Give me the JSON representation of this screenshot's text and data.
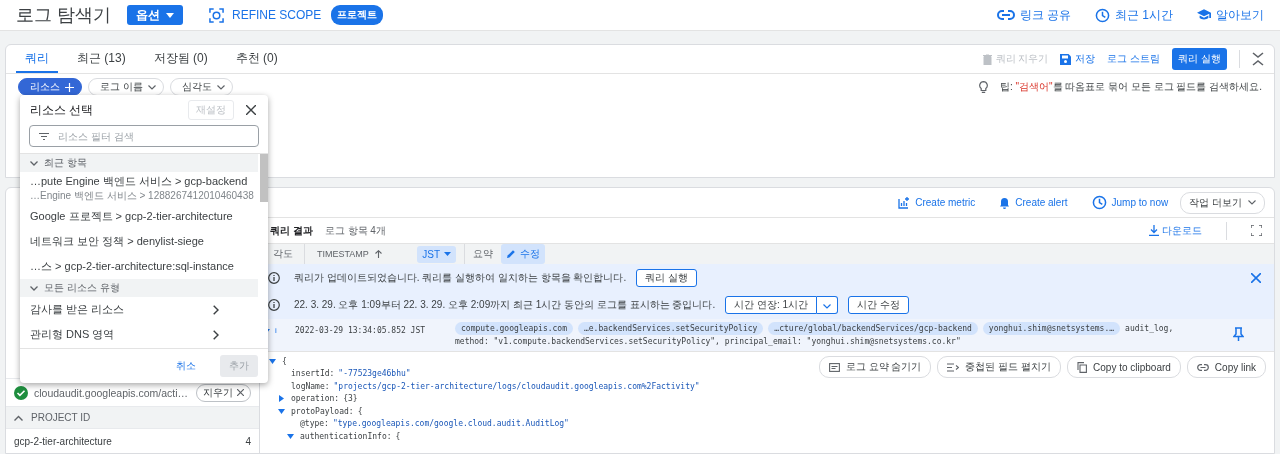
{
  "header": {
    "title": "로그 탐색기",
    "options_button": "옵션",
    "refine_scope": "REFINE SCOPE",
    "scope_badge": "프로젝트",
    "actions": [
      {
        "label": "링크 공유",
        "kind": "link"
      },
      {
        "label": "최근 1시간",
        "kind": "clock"
      },
      {
        "label": "알아보기",
        "kind": "learn"
      }
    ]
  },
  "query": {
    "tabs": [
      {
        "label": "쿼리",
        "selected": true
      },
      {
        "label": "최근 (13)",
        "selected": false
      },
      {
        "label": "저장됨 (0)",
        "selected": false
      },
      {
        "label": "추천 (0)",
        "selected": false
      }
    ],
    "actions": [
      {
        "label": "쿼리 지우기",
        "kind": "clear",
        "disabled": true
      },
      {
        "label": "저장",
        "kind": "save",
        "disabled": false
      },
      {
        "label": "로그 스트림",
        "kind": "stream",
        "disabled": false
      },
      {
        "label": "쿼리 실행",
        "kind": "run",
        "disabled": false
      }
    ],
    "chips": [
      {
        "label": "리소스",
        "selected": true
      },
      {
        "label": "로그 이름",
        "selected": false
      },
      {
        "label": "심각도",
        "selected": false
      }
    ],
    "tip": {
      "prefix": "팁:",
      "term": "\"검색어\"",
      "suffix": "를 따옴표로 묶어 모든 로그 필드를 검색하세요."
    }
  },
  "resource_picker": {
    "title": "리소스 선택",
    "reset": "재설정",
    "search_placeholder": "리소스 필터 검색",
    "sections": [
      {
        "title": "최근 항목",
        "items": [
          {
            "label": "…pute Engine 백엔드 서비스 > gcp-backend",
            "sublabel": "…Engine 백엔드 서비스 > 1288267412010460438"
          },
          {
            "label": "Google 프로젝트 > gcp-2-tier-architecture"
          },
          {
            "label": "네트워크 보안 정책 > denylist-siege"
          },
          {
            "label": "…스 > gcp-2-tier-architecture:sql-instance"
          }
        ]
      },
      {
        "title": "모든 리소스 유형",
        "items": [
          {
            "label": "감사를 받은 리소스",
            "submenu": true
          },
          {
            "label": "관리형 DNS 영역",
            "submenu": true
          }
        ]
      }
    ],
    "cancel": "취소",
    "add": "추가"
  },
  "field_explorer": {
    "rows": [
      {
        "kind": "value",
        "label": "cloudaudit.googleapis.com/acti…",
        "checked": true,
        "chip": "지우기"
      },
      {
        "kind": "header",
        "label": "PROJECT ID",
        "expanded": true
      },
      {
        "kind": "count",
        "label": "gcp-2-tier-architecture",
        "count": "4"
      }
    ]
  },
  "results": {
    "toolbar": [
      {
        "label": "Create metric",
        "kind": "metric"
      },
      {
        "label": "Create alert",
        "kind": "alert"
      },
      {
        "label": "Jump to now",
        "kind": "clock"
      }
    ],
    "more_actions": "작업 더보기",
    "title": "쿼리 결과",
    "count": "로그 항목 4개",
    "download": "다운로드",
    "columns": [
      {
        "label": "각도",
        "kind": "plain"
      },
      {
        "label": "TIMESTAMP",
        "kind": "timestamp",
        "timezone": "JST"
      },
      {
        "label": "요약",
        "kind": "summary",
        "edit": "수정"
      }
    ],
    "banners": [
      {
        "text": "쿼리가 업데이트되었습니다. 쿼리를 실행하여 일치하는 항목을 확인합니다.",
        "buttons": [
          "쿼리 실행"
        ],
        "closable": true
      },
      {
        "text": "22. 3. 29. 오후 1:09부터 22. 3. 29. 오후 2:09까지 최근 1시간 동안의 로그를 표시하는 중입니다.",
        "split_button": "시간 연장: 1시간",
        "buttons": [
          "시간 수정"
        ],
        "closable": false
      }
    ],
    "entry": {
      "severity": "i",
      "timestamp": "2022-03-29 13:34:05.852 JST",
      "chips": [
        "compute.googleapis.com",
        "…e.backendServices.setSecurityPolicy",
        "…cture/global/backendServices/gcp-backend",
        "yonghui.shim@snetsystems.…"
      ],
      "tail": "audit_log,",
      "line2": "method: \"v1.compute.backendServices.setSecurityPolicy\", principal_email: \"yonghui.shim@snetsystems.co.kr\"",
      "expanded": true
    },
    "detail_actions": [
      {
        "label": "로그 요약 숨기기",
        "kind": "summary"
      },
      {
        "label": "중첩된 필드 펼치기",
        "kind": "expand"
      },
      {
        "label": "Copy to clipboard",
        "kind": "copy"
      },
      {
        "label": "Copy link",
        "kind": "link"
      }
    ],
    "json": {
      "value": "{",
      "expanded": true,
      "children": [
        {
          "key": "insertId:",
          "value": "\"-77523ge46bhu\""
        },
        {
          "key": "logName:",
          "value": "\"projects/gcp-2-tier-architecture/logs/cloudaudit.googleapis.com%2Factivity\""
        },
        {
          "key": "operation:",
          "value": "{3}",
          "expanded": false
        },
        {
          "key": "protoPayload:",
          "value": "{",
          "expanded": true,
          "children": [
            {
              "key": "@type:",
              "value": "\"type.googleapis.com/google.cloud.audit.AuditLog\""
            },
            {
              "key": "authenticationInfo:",
              "value": "{",
              "expanded": true
            }
          ]
        }
      ]
    }
  }
}
